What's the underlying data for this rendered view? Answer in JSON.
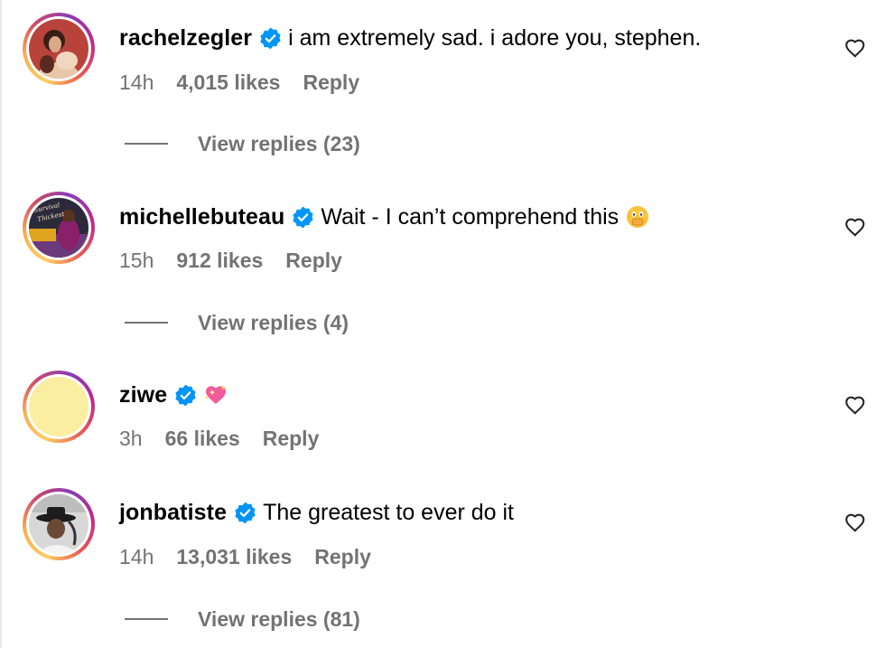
{
  "comments": [
    {
      "username": "rachelzegler",
      "verified": true,
      "text": "i am extremely sad. i adore you, stephen.",
      "time": "14h",
      "likes": "4,015 likes",
      "reply_label": "Reply",
      "view_replies": "View replies (23)",
      "liked": false
    },
    {
      "username": "michellebuteau",
      "verified": true,
      "text": "Wait - I can’t comprehend this",
      "emoji": "face-with-open-eyes-and-hand-over-mouth",
      "time": "15h",
      "likes": "912 likes",
      "reply_label": "Reply",
      "view_replies": "View replies (4)",
      "liked": false,
      "avatar_text": "Survival of the Thickest"
    },
    {
      "username": "ziwe",
      "verified": true,
      "text": "",
      "emoji": "sparkling-heart",
      "time": "3h",
      "likes": "66 likes",
      "reply_label": "Reply",
      "liked": false
    },
    {
      "username": "jonbatiste",
      "verified": true,
      "text": "The greatest to ever do it",
      "time": "14h",
      "likes": "13,031 likes",
      "reply_label": "Reply",
      "view_replies": "View replies (81)",
      "liked": false
    }
  ],
  "colors": {
    "verified_blue": "#0095f6",
    "secondary_text": "#737373",
    "primary_text": "#000000"
  }
}
